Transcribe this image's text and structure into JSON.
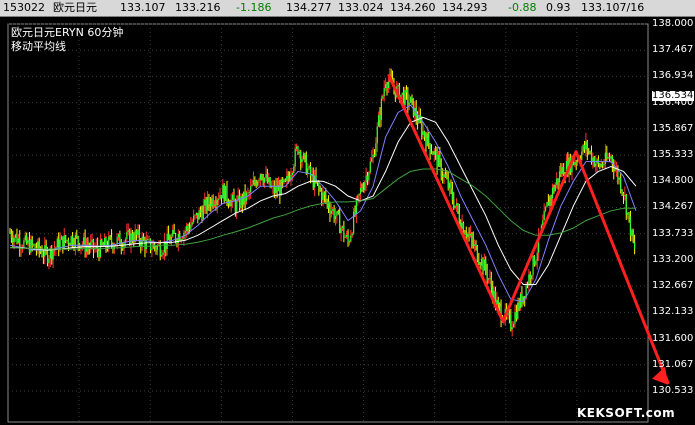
{
  "quote_bar": {
    "time": "153022",
    "name": "欧元日元",
    "open": "133.107",
    "high": "133.216",
    "change": "-1.186",
    "low": "134.277",
    "close": "133.024",
    "bid": "134.260",
    "ask": "134.293",
    "change2": "-0.88",
    "pct": "0.93",
    "last": "133.107/16",
    "colors": {
      "text": "#000000",
      "change": "#008000"
    }
  },
  "chart_header": {
    "title": "欧元日元ERYN   60分钟",
    "indicator": "移动平均线"
  },
  "price_axis": {
    "labels": [
      "138.000",
      "137.467",
      "136.934",
      "136.400",
      "135.867",
      "135.333",
      "134.800",
      "134.267",
      "133.733",
      "133.200",
      "132.667",
      "132.133",
      "131.600",
      "131.067",
      "130.533"
    ],
    "current": "136.534"
  },
  "watermark": "KEKSOFT.com",
  "colors": {
    "background": "#000000",
    "grid": "#3a3a3a",
    "candle_up": "#ff3030",
    "candle_down": "#ffff00",
    "candle_body": "#30ff30",
    "ma_short": "#8080ff",
    "ma_mid": "#ffffff",
    "ma_long": "#40a040",
    "arrow": "#ff2020"
  },
  "chart_data": {
    "type": "line",
    "title": "欧元日元ERYN   60分钟",
    "xlabel": "",
    "ylabel": "",
    "ylim": [
      130.3,
      138.2
    ],
    "yticks": [
      138.0,
      137.467,
      136.934,
      136.4,
      135.867,
      135.333,
      134.8,
      134.267,
      133.733,
      133.2,
      132.667,
      132.133,
      131.6,
      131.067,
      130.533
    ],
    "grid": true,
    "price_path": [
      133.75,
      133.55,
      133.45,
      133.3,
      133.55,
      133.65,
      133.5,
      133.4,
      133.55,
      133.6,
      133.7,
      133.5,
      133.45,
      133.65,
      133.8,
      134.1,
      134.4,
      134.6,
      134.3,
      134.5,
      135.0,
      134.6,
      134.7,
      135.5,
      134.9,
      134.5,
      134.1,
      133.55,
      134.6,
      135.3,
      136.9,
      136.6,
      136.4,
      135.8,
      135.3,
      134.7,
      134.0,
      133.5,
      133.0,
      132.2,
      131.9,
      132.5,
      133.3,
      134.4,
      135.0,
      135.2,
      135.5,
      135.1,
      135.3,
      134.6,
      133.2
    ],
    "series": [
      {
        "name": "",
        "values": [
          133.5,
          133.45,
          133.4,
          133.4,
          133.45,
          133.5,
          133.5,
          133.48,
          133.5,
          133.55,
          133.6,
          133.58,
          133.55,
          133.6,
          133.7,
          133.9,
          134.15,
          134.35,
          134.4,
          134.5,
          134.7,
          134.7,
          134.7,
          135.0,
          134.95,
          134.7,
          134.4,
          134.0,
          134.2,
          134.7,
          135.7,
          136.2,
          136.35,
          136.0,
          135.6,
          135.1,
          134.5,
          134.0,
          133.5,
          132.9,
          132.4,
          132.35,
          132.8,
          133.6,
          134.3,
          134.8,
          135.2,
          135.2,
          135.2,
          134.9,
          134.2
        ]
      },
      {
        "name": "",
        "values": [
          133.45,
          133.45,
          133.42,
          133.4,
          133.42,
          133.45,
          133.47,
          133.47,
          133.48,
          133.5,
          133.53,
          133.55,
          133.55,
          133.56,
          133.6,
          133.7,
          133.85,
          134.0,
          134.15,
          134.25,
          134.4,
          134.5,
          134.55,
          134.7,
          134.8,
          134.8,
          134.7,
          134.5,
          134.4,
          134.5,
          135.0,
          135.6,
          136.0,
          136.1,
          136.0,
          135.6,
          135.1,
          134.6,
          134.1,
          133.5,
          133.0,
          132.7,
          132.7,
          133.1,
          133.7,
          134.3,
          134.8,
          135.0,
          135.1,
          135.0,
          134.7
        ]
      },
      {
        "name": "",
        "values": [
          133.45,
          133.44,
          133.43,
          133.42,
          133.42,
          133.42,
          133.43,
          133.43,
          133.44,
          133.45,
          133.47,
          133.48,
          133.5,
          133.5,
          133.52,
          133.56,
          133.62,
          133.7,
          133.77,
          133.85,
          133.95,
          134.05,
          134.12,
          134.22,
          134.3,
          134.35,
          134.38,
          134.38,
          134.4,
          134.45,
          134.65,
          134.85,
          135.0,
          135.05,
          135.05,
          135.0,
          134.85,
          134.7,
          134.5,
          134.25,
          134.0,
          133.8,
          133.7,
          133.7,
          133.75,
          133.85,
          134.0,
          134.1,
          134.2,
          134.25,
          134.25
        ]
      }
    ],
    "annotation_lines": [
      {
        "values": [
          136.95,
          131.95
        ],
        "color": "arrow"
      },
      {
        "values": [
          131.95,
          135.4
        ],
        "color": "arrow"
      },
      {
        "values": [
          135.4,
          130.7
        ],
        "color": "arrow",
        "arrowhead": true
      }
    ]
  }
}
